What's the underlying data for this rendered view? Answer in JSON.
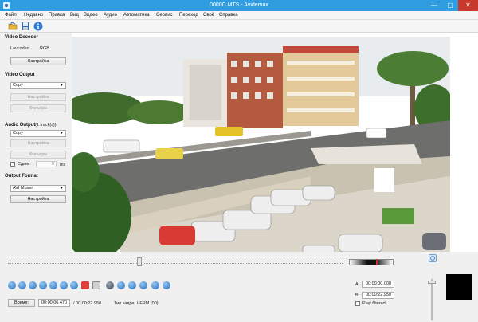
{
  "window": {
    "title": "0000C.MTS - Avidemux",
    "min": "—",
    "max": "▢",
    "close": "✕"
  },
  "menu": [
    "Файл",
    "Недавно",
    "Правка",
    "Вид",
    "Видео",
    "Аудио",
    "Автоматика",
    "Сервис",
    "Переход",
    "Своё",
    "Справка"
  ],
  "toolbar": {
    "icons": [
      "open-file-icon",
      "save-file-icon",
      "info-icon"
    ]
  },
  "video_decoder": {
    "title": "Video Decoder",
    "label": "Lavcodec",
    "value": "RGB",
    "config_button": "Настройка"
  },
  "video_output": {
    "title": "Video Output",
    "codec": "Copy",
    "config_button": "Настройка",
    "filters_button": "Фильтры"
  },
  "audio_output": {
    "title": "Audio Output",
    "tracks": "(1 track(s))",
    "codec": "Copy",
    "config_button": "Настройка",
    "filters_button": "Фильтры",
    "shift_label": "Сдвиг:",
    "shift_value": "0",
    "shift_unit": "ms"
  },
  "output_format": {
    "title": "Output Format",
    "container": "AVI Muxer",
    "config_button": "Настройка"
  },
  "controls": {
    "buttons": [
      "play-icon",
      "rewind-icon",
      "back-one-frame-icon",
      "forward-one-frame-icon",
      "previous-keyframe-icon",
      "next-keyframe-icon",
      "set-a-marker-icon",
      "set-b-marker-icon",
      "previous-cut-icon",
      "goto-a-icon",
      "goto-b-icon",
      "previous-black-icon",
      "next-black-icon",
      "first-frame-icon",
      "last-frame-icon"
    ]
  },
  "status": {
    "time_button": "Время:",
    "current_time": "00:00:06.470",
    "duration": "/ 00:00:22.950",
    "frame_type_label": "Тип кадра:",
    "frame_type_value": "I-FRM (00)"
  },
  "selection": {
    "a_label": "A:",
    "a_value": "00:00:00.000",
    "b_label": "B:",
    "b_value": "00:00:22.950",
    "play_filtered": "Play filtered"
  }
}
